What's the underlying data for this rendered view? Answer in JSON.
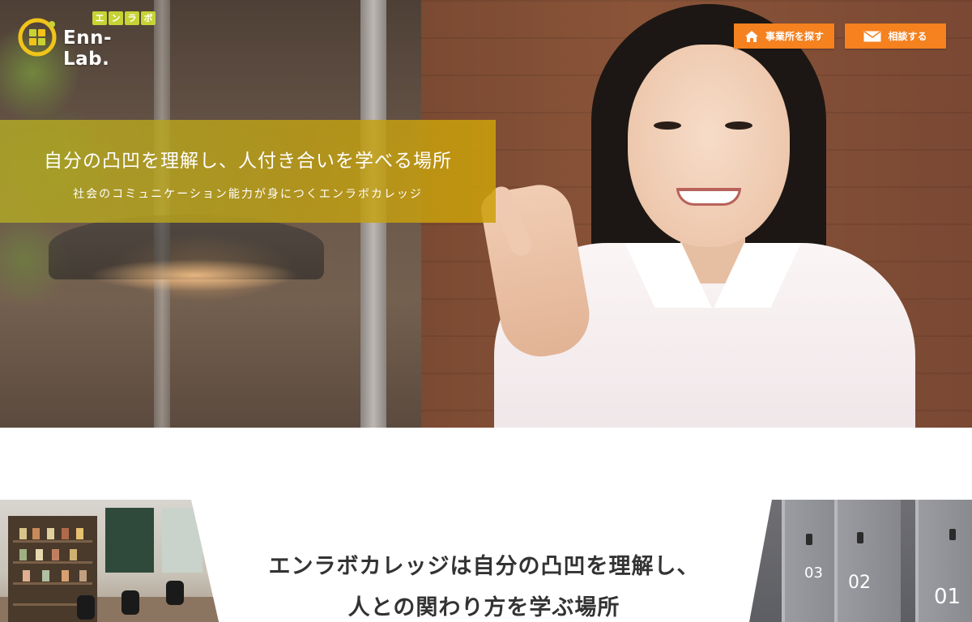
{
  "logo": {
    "kana": [
      "エ",
      "ン",
      "ラ",
      "ボ"
    ],
    "wordmark": "Enn-Lab."
  },
  "header": {
    "find_office_label": "事業所を探す",
    "find_office_icon": "home-icon",
    "consult_label": "相談する",
    "consult_icon": "mail-icon"
  },
  "hero": {
    "catch_main": "自分の凸凹を理解し、人付き合いを学べる場所",
    "catch_sub": "社会のコミュニケーション能力が身につくエンラボカレッジ"
  },
  "intro": {
    "title_line1": "エンラボカレッジは自分の凸凹を理解し、",
    "title_line2": "人との関わり方を学ぶ場所",
    "booth_numbers": [
      "03",
      "02",
      "01"
    ]
  },
  "colors": {
    "accent_orange": "#f5811f",
    "logo_green": "#c7d335",
    "logo_yellow": "#f0c419",
    "catch_band": "#b4a826"
  }
}
